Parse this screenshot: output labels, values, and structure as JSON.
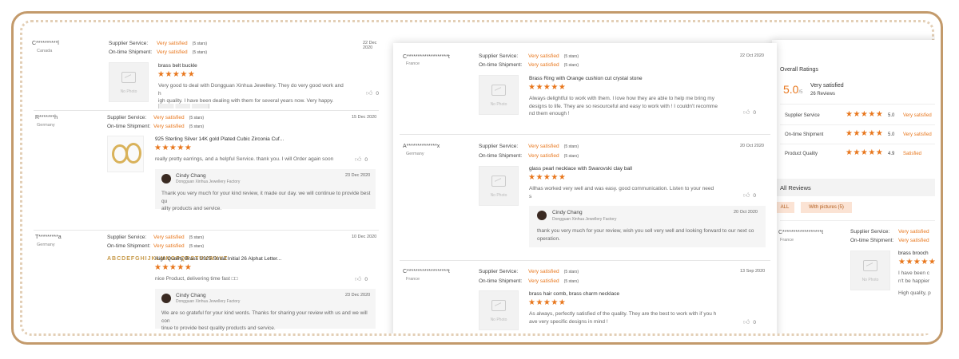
{
  "colors": {
    "accent": "#e8771d",
    "frame": "#c39a6b",
    "dots": "#e3cfb6"
  },
  "left": {
    "r1": {
      "user": "C**********l",
      "country": "Canada",
      "date": "22 Dec 2020",
      "supplier_label": "Supplier Service:",
      "supplier_val": "Very satisfied",
      "supplier_stars": "(5 stars)",
      "ship_label": "On-time Shipment:",
      "ship_val": "Very satisfied",
      "ship_stars": "(5 stars)",
      "product": "brass belt buckle",
      "text1": "Very good to deal with Dongguan Xinhua Jewellery. They do very good work and h",
      "text2": "igh quality. I have been dealing with them for several years now. Very happy.",
      "likes": "0",
      "nophoto": "No Photo"
    },
    "r2": {
      "user": "R*******h",
      "country": "Germany",
      "date": "15 Dec 2020",
      "supplier_label": "Supplier Service:",
      "supplier_val": "Very satisfied",
      "supplier_stars": "(5 stars)",
      "ship_label": "On-time Shipment:",
      "ship_val": "Very satisfied",
      "ship_stars": "(5 stars)",
      "product": "925 Sterling Silver 14K gold Plated Cubic Zirconia Cuf...",
      "text1": "really pretty earrings, and a helpful Service. thank you. I will Order again soon",
      "likes": "0",
      "reply_name": "Cindy Chang",
      "reply_sub": "Dongguan Xinhua Jewellery Factory",
      "reply_date": "23 Dec 2020",
      "reply1": "Thank you very much for your kind review, it made our day. we will continue to provide best qu",
      "reply2": "ality products and service."
    },
    "r3": {
      "user": "T*********a",
      "country": "Germany",
      "date": "10 Dec 2020",
      "supplier_label": "Supplier Service:",
      "supplier_val": "Very satisfied",
      "supplier_stars": "(5 stars)",
      "ship_label": "On-time Shipment:",
      "ship_val": "Very satisfied",
      "ship_stars": "(5 stars)",
      "product": "High Quality Brass S925 Small Initial 26 Alphat Letter...",
      "text1": "nice Product, delivering time fast □□",
      "likes": "0",
      "reply_name": "Cindy Chang",
      "reply_sub": "Dongguan Xinhua Jewellery Factory",
      "reply_date": "23 Dec 2020",
      "reply1": "We are so grateful for your kind words. Thanks for sharing your review with us and we will con",
      "reply2": "tinue to provide best quality products and service.",
      "alphabet": "ABCDEFGHIJKLMNOPQRSTUVWXYZ"
    }
  },
  "middle": {
    "r1": {
      "user": "C*******************t",
      "country": "France",
      "date": "22 Oct 2020",
      "supplier_label": "Supplier Service:",
      "supplier_val": "Very satisfied",
      "supplier_stars": "(5 stars)",
      "ship_label": "On-time Shipment:",
      "ship_val": "Very satisfied",
      "ship_stars": "(5 stars)",
      "product": "Brass Ring with Orange cushion cut crystal stone",
      "text1": "Always delightful to work with them. I love how they are able to help me bring my",
      "text2": "designs to life. They are so resourceful and easy to work with ! I couldn't recomme",
      "text3": "nd them enough !",
      "likes": "0",
      "nophoto": "No Photo"
    },
    "r2": {
      "user": "A**************x",
      "country": "Germany",
      "date": "20 Oct 2020",
      "supplier_label": "Supplier Service:",
      "supplier_val": "Very satisfied",
      "supplier_stars": "(5 stars)",
      "ship_label": "On-time Shipment:",
      "ship_val": "Very satisfied",
      "ship_stars": "(5 stars)",
      "product": "glass pearl necklace with Swarovski clay ball",
      "text1": "Allhas worked very well and was easy. good communication. Listen to your need",
      "text2": "s",
      "likes": "0",
      "nophoto": "No Photo",
      "reply_name": "Cindy Chang",
      "reply_sub": "Dongguan Xinhua Jewellery Factory",
      "reply_date": "20 Oct 2020",
      "reply1": "thank you very much for your review, wish you sell very well and looking forward to our next co",
      "reply2": "operation."
    },
    "r3": {
      "user": "C*******************t",
      "country": "France",
      "date": "13 Sep 2020",
      "supplier_label": "Supplier Service:",
      "supplier_val": "Very satisfied",
      "supplier_stars": "(5 stars)",
      "ship_label": "On-time Shipment:",
      "ship_val": "Very satisfied",
      "ship_stars": "(5 stars)",
      "product": "brass hair comb, brass charm necklace",
      "text1": "As always, perfectly satisfied of the quality. They are the best to work with if you h",
      "text2": "ave very specific designs in mind !",
      "likes": "0",
      "nophoto": "No Photo"
    }
  },
  "right": {
    "overall_title": "Overall Ratings",
    "score": "5.0",
    "score_den": "/5",
    "score_text": "Very satisfied",
    "reviews_count": "26 Reviews",
    "rows": [
      {
        "label": "Supplier Service",
        "num": "5.0",
        "text": "Very satisfied"
      },
      {
        "label": "On-time Shipment",
        "num": "5.0",
        "text": "Very satisfied"
      },
      {
        "label": "Product Quality",
        "num": "4.9",
        "text": "Satisfied"
      }
    ],
    "all_reviews": "All Reviews",
    "btn_all": "ALL",
    "btn_pics": "With pictures",
    "btn_pics_count": "(5)",
    "r1": {
      "user": "C******************t",
      "country": "France",
      "supplier_label": "Supplier Service:",
      "supplier_val": "Very satisfied",
      "ship_label": "On-time Shipment:",
      "ship_val": "Very satisfied",
      "product": "brass brooch",
      "text1": "I have been c",
      "text2": "n't be happier",
      "text3": "High quality, p",
      "nophoto": "No Photo"
    }
  },
  "stars": "★★★★★"
}
